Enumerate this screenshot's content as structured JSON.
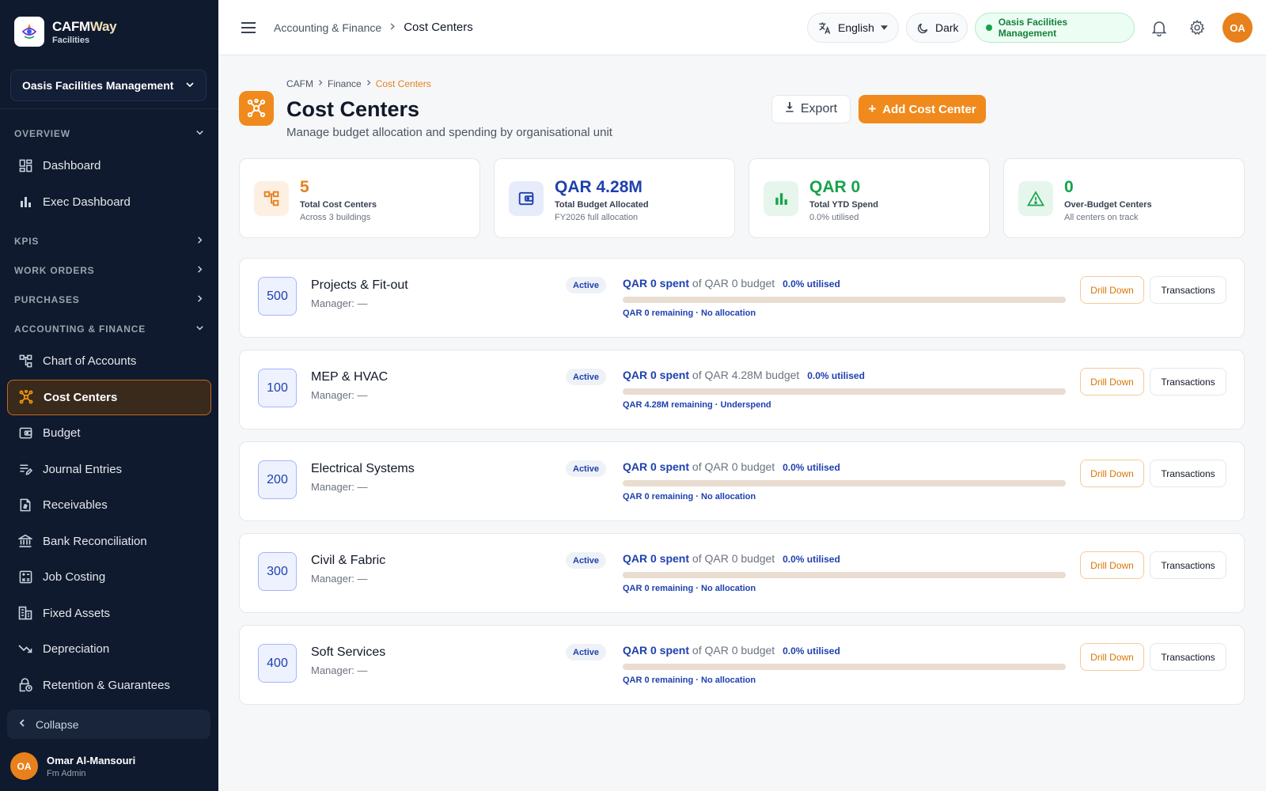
{
  "brand": {
    "name_a": "CAFM",
    "name_b": "Way",
    "sub": "Facilities"
  },
  "sidebar": {
    "org": "Oasis Facilities Management",
    "overview_label": "OVERVIEW",
    "overview_items": [
      {
        "label": "Dashboard",
        "icon": "dashboard-icon"
      },
      {
        "label": "Exec Dashboard",
        "icon": "bar-chart-icon"
      }
    ],
    "kpis_label": "KPIS",
    "work_orders_label": "WORK ORDERS",
    "purchases_label": "PURCHASES",
    "accounting_label": "ACCOUNTING & FINANCE",
    "accounting_items": [
      {
        "label": "Chart of Accounts",
        "icon": "account-tree-icon"
      },
      {
        "label": "Cost Centers",
        "icon": "hub-icon"
      },
      {
        "label": "Budget",
        "icon": "wallet-icon"
      },
      {
        "label": "Journal Entries",
        "icon": "edit-list-icon"
      },
      {
        "label": "Receivables",
        "icon": "receipt-icon"
      },
      {
        "label": "Bank Reconciliation",
        "icon": "bank-icon"
      },
      {
        "label": "Job Costing",
        "icon": "calculator-icon"
      },
      {
        "label": "Fixed Assets",
        "icon": "building-icon"
      },
      {
        "label": "Depreciation",
        "icon": "trending-down-icon"
      },
      {
        "label": "Retention & Guarantees",
        "icon": "lock-clock-icon"
      }
    ],
    "collapse": "Collapse",
    "user": {
      "initials": "OA",
      "name": "Omar Al-Mansouri",
      "role": "Fm Admin"
    }
  },
  "topbar": {
    "crumb_parent": "Accounting & Finance",
    "crumb_current": "Cost Centers",
    "language": "English",
    "theme": "Dark",
    "org": "Oasis Facilities Management",
    "avatar": "OA"
  },
  "header": {
    "crumbs": [
      "CAFM",
      "Finance",
      "Cost Centers"
    ],
    "title": "Cost Centers",
    "subtitle": "Manage budget allocation and spending by organisational unit",
    "export": "Export",
    "add": "Add Cost Center"
  },
  "stats": [
    {
      "value": "5",
      "label": "Total Cost Centers",
      "note": "Across 3 buildings",
      "color": "#e8801c"
    },
    {
      "value": "QAR 4.28M",
      "label": "Total Budget Allocated",
      "note": "FY2026 full allocation",
      "color": "#1e40af"
    },
    {
      "value": "QAR 0",
      "label": "Total YTD Spend",
      "note": "0.0% utilised",
      "color": "#16a34a"
    },
    {
      "value": "0",
      "label": "Over-Budget Centers",
      "note": "All centers on track",
      "color": "#16a34a"
    }
  ],
  "cost_centers": [
    {
      "code": "500",
      "name": "Projects & Fit-out",
      "manager": "Manager: —",
      "status": "Active",
      "spent": "QAR 0 spent",
      "budget": "of QAR 0 budget",
      "utilised": "0.0% utilised",
      "utilised_pct": 0,
      "remaining": "QAR 0 remaining · No allocation"
    },
    {
      "code": "100",
      "name": "MEP & HVAC",
      "manager": "Manager: —",
      "status": "Active",
      "spent": "QAR 0 spent",
      "budget": "of QAR 4.28M budget",
      "utilised": "0.0% utilised",
      "utilised_pct": 0,
      "remaining": "QAR 4.28M remaining · Underspend"
    },
    {
      "code": "200",
      "name": "Electrical Systems",
      "manager": "Manager: —",
      "status": "Active",
      "spent": "QAR 0 spent",
      "budget": "of QAR 0 budget",
      "utilised": "0.0% utilised",
      "utilised_pct": 0,
      "remaining": "QAR 0 remaining · No allocation"
    },
    {
      "code": "300",
      "name": "Civil & Fabric",
      "manager": "Manager: —",
      "status": "Active",
      "spent": "QAR 0 spent",
      "budget": "of QAR 0 budget",
      "utilised": "0.0% utilised",
      "utilised_pct": 0,
      "remaining": "QAR 0 remaining · No allocation"
    },
    {
      "code": "400",
      "name": "Soft Services",
      "manager": "Manager: —",
      "status": "Active",
      "spent": "QAR 0 spent",
      "budget": "of QAR 0 budget",
      "utilised": "0.0% utilised",
      "utilised_pct": 0,
      "remaining": "QAR 0 remaining · No allocation"
    }
  ],
  "row_actions": {
    "drill": "Drill Down",
    "transactions": "Transactions"
  }
}
